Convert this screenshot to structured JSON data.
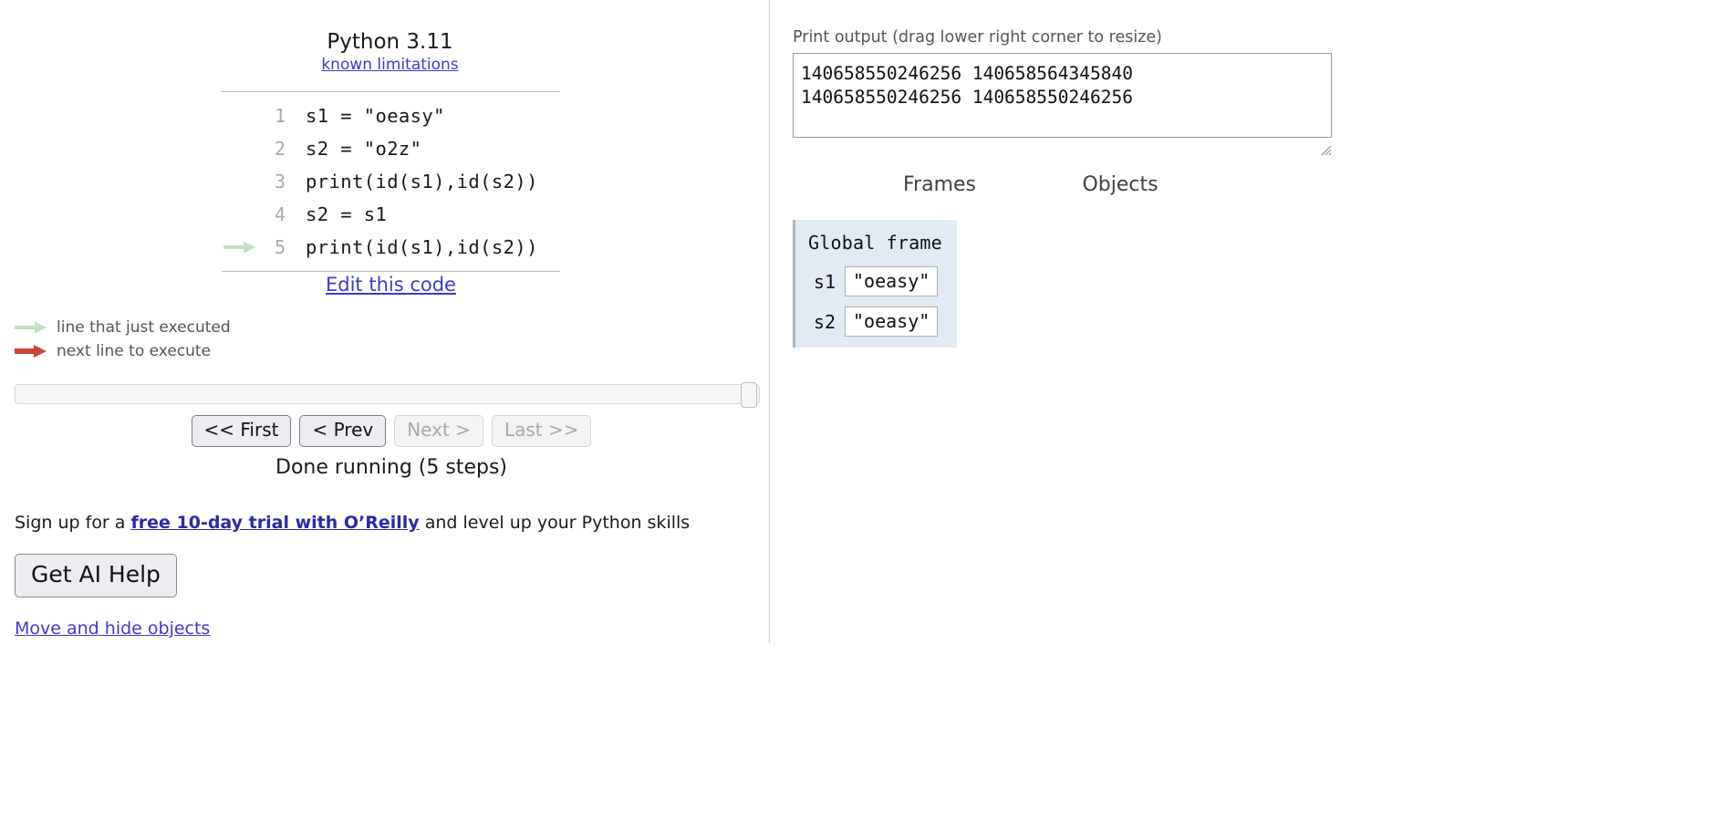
{
  "header": {
    "python_version": "Python 3.11",
    "known_limitations_label": "known limitations"
  },
  "code": {
    "lines": [
      {
        "number": "1",
        "text": "s1 = \"oeasy\"",
        "arrow": "none"
      },
      {
        "number": "2",
        "text": "s2 = \"o2z\"",
        "arrow": "none"
      },
      {
        "number": "3",
        "text": "print(id(s1),id(s2))",
        "arrow": "none"
      },
      {
        "number": "4",
        "text": "s2 = s1",
        "arrow": "none"
      },
      {
        "number": "5",
        "text": "print(id(s1),id(s2))",
        "arrow": "green"
      }
    ],
    "edit_link_label": "Edit this code"
  },
  "legend": {
    "just_executed_label": "line that just executed",
    "next_line_label": "next line to execute",
    "just_executed_color": "#c3e0c0",
    "next_line_color": "#cc4436"
  },
  "controls": {
    "first_label": "<< First",
    "prev_label": "< Prev",
    "next_label": "Next >",
    "last_label": "Last >>",
    "first_enabled": true,
    "prev_enabled": true,
    "next_enabled": false,
    "last_enabled": false,
    "status": "Done running (5 steps)"
  },
  "promo": {
    "prefix": "Sign up for a ",
    "link_label": "free 10-day trial with O’Reilly",
    "suffix": " and level up your Python skills",
    "ai_help_label": "Get AI Help",
    "move_hide_label": "Move and hide objects"
  },
  "output": {
    "label": "Print output (drag lower right corner to resize)",
    "text": "140658550246256 140658564345840\n140658550246256 140658550246256"
  },
  "panels": {
    "frames_label": "Frames",
    "objects_label": "Objects",
    "global_frame_title": "Global frame",
    "variables": [
      {
        "name": "s1",
        "value": "\"oeasy\""
      },
      {
        "name": "s2",
        "value": "\"oeasy\""
      }
    ]
  },
  "colors": {
    "link": "#3b3bcf",
    "frame_bg": "#e2eaf4",
    "frame_border": "#a7b5c4"
  }
}
